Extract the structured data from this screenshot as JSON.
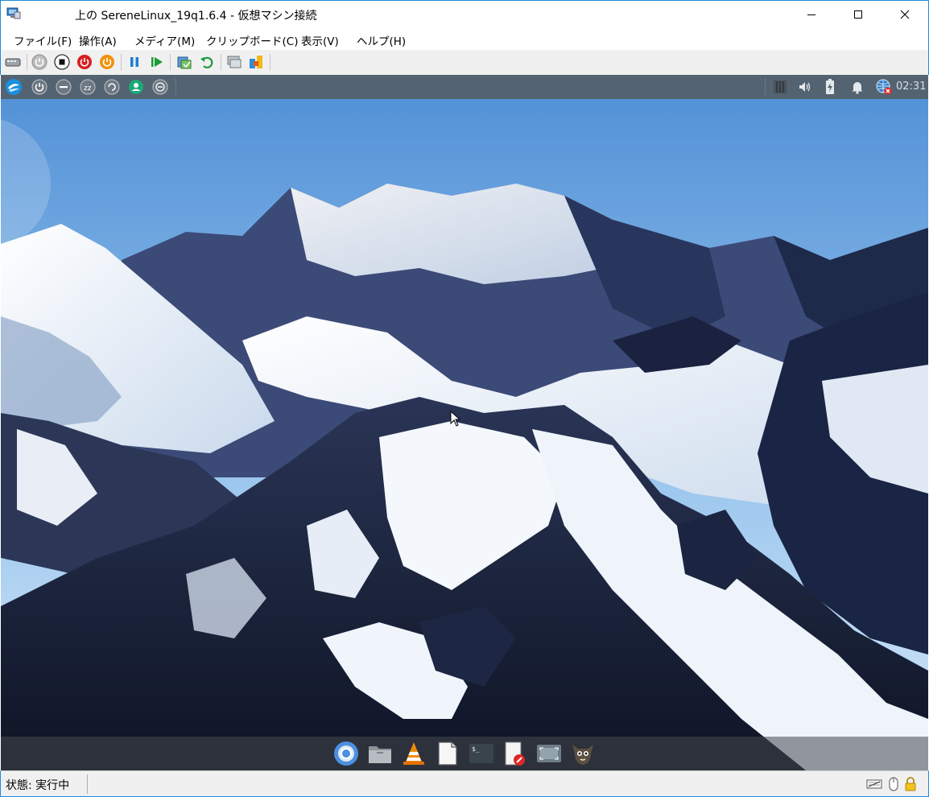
{
  "window": {
    "title": "上の SereneLinux_19q1.6.4  - 仮想マシン接続",
    "app_icon": "vm-connection-icon"
  },
  "menu": {
    "items": [
      {
        "label": "ファイル(F)"
      },
      {
        "label": "操作(A)"
      },
      {
        "label": "メディア(M)"
      },
      {
        "label": "クリップボード(C)"
      },
      {
        "label": "表示(V)"
      },
      {
        "label": "ヘルプ(H)"
      }
    ]
  },
  "toolbar": {
    "icons": [
      "ctrl-alt-del-icon",
      "start-icon",
      "turn-off-icon",
      "shutdown-icon",
      "power-icon",
      "pause-icon",
      "resume-icon",
      "checkpoint-icon",
      "revert-icon",
      "enhanced-session-icon",
      "share-icon"
    ]
  },
  "vm": {
    "panel": {
      "clock": "02:31",
      "left_icons": [
        "serene-menu-icon",
        "power-icon",
        "lock-icon",
        "sleep-icon",
        "restart-icon",
        "user-icon",
        "logout-icon"
      ],
      "right_icons": [
        "workspace-icon",
        "volume-icon",
        "battery-icon",
        "notification-bell-icon",
        "network-disconnected-icon"
      ]
    },
    "dock": {
      "apps": [
        "chromium-icon",
        "file-manager-icon",
        "vlc-icon",
        "text-editor-icon",
        "terminal-icon",
        "drawing-icon",
        "screenshot-icon",
        "gimp-icon"
      ]
    }
  },
  "status": {
    "text": "状態: 実行中",
    "icons": [
      "keyboard-icon",
      "mouse-icon",
      "lock-icon"
    ]
  },
  "colors": {
    "accent_border": "#1d8cd6",
    "panel_bg": "#555f68",
    "sky_top": "#4f8fd6",
    "snow": "#f2f6fb",
    "rock": "#1c2438"
  }
}
